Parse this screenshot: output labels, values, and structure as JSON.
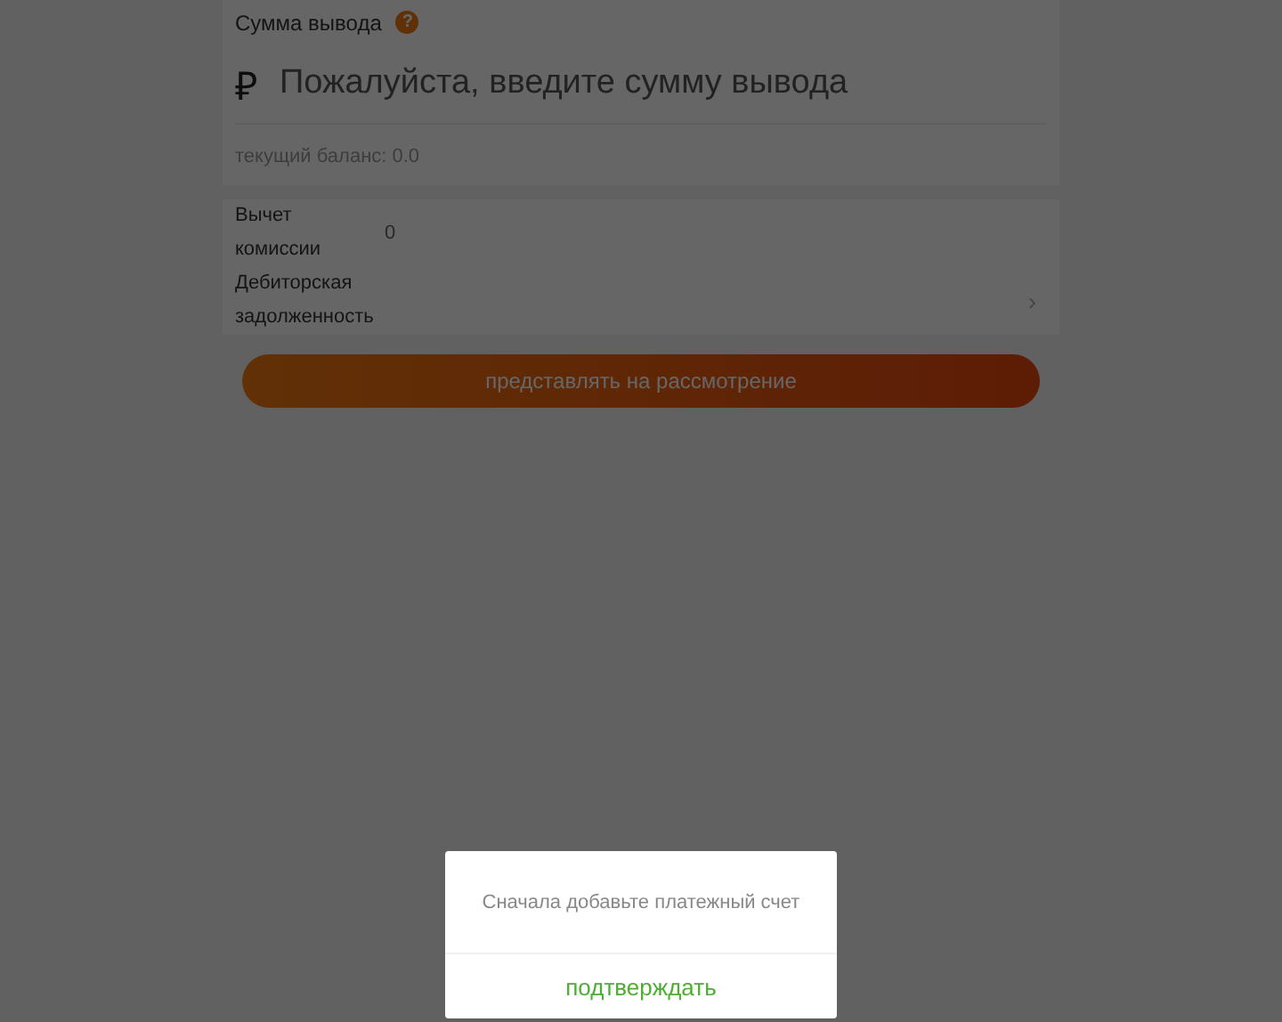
{
  "amount": {
    "label": "Сумма вывода",
    "help": "?",
    "currency": "₽",
    "placeholder": "Пожалуйста, введите сумму вывода",
    "balance": "текущий баланс: 0.0"
  },
  "details": [
    {
      "label": "Вычет комиссии",
      "value": "0"
    },
    {
      "label": "Дебиторская задолженность",
      "chevron": "›"
    }
  ],
  "submit": "представлять на рассмотрение",
  "dialog": {
    "message": "Сначала добавьте платежный счет",
    "confirm": "подтверждать"
  }
}
